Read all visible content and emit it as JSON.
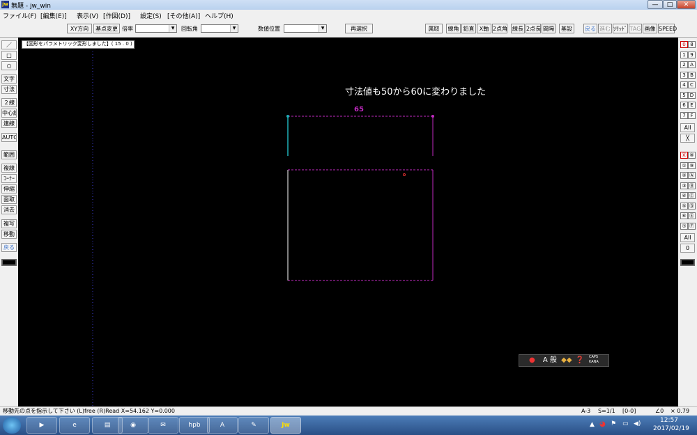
{
  "window": {
    "title": "無題 - jw_win",
    "app_icon": "jw",
    "minimize": "—",
    "maximize": "□",
    "close": "✕"
  },
  "menu": [
    "ファイル(F)",
    "[編集(E)]",
    "表示(V)",
    "[作図(D)]",
    "設定(S)",
    "[その他(A)]",
    "ヘルプ(H)"
  ],
  "toolbar": {
    "xy_direction": "XY方向",
    "base_change": "基点変更",
    "scale_label": "倍率",
    "scale_value": "",
    "rotation_label": "回転角",
    "rotation_value": "",
    "numpos_label": "数値位置",
    "numpos_value": "",
    "reselect": "再選択",
    "right_buttons": [
      "属取",
      "線角",
      "鉛直",
      "X軸",
      "2点角",
      "線長",
      "2点長",
      "間隔",
      "基設"
    ],
    "far_right": [
      "戻る",
      "進む",
      "ｿﾘｯﾄﾞ",
      "TAG",
      "画像",
      "SPEED"
    ]
  },
  "left_tools": [
    "／",
    "□",
    "○",
    "文字",
    "寸法",
    "２線",
    "中心線",
    "連線",
    "AUTO",
    "範囲",
    "複線",
    "ｺｰﾅｰ",
    "伸縮",
    "面取",
    "消去",
    "複写",
    "移動",
    "戻る"
  ],
  "right_layers": {
    "group_a": [
      [
        "0",
        "8"
      ],
      [
        "1",
        "9"
      ],
      [
        "2",
        "A"
      ],
      [
        "3",
        "B"
      ],
      [
        "4",
        "C"
      ],
      [
        "5",
        "D"
      ],
      [
        "6",
        "E"
      ],
      [
        "7",
        "F"
      ]
    ],
    "all_a": "All",
    "x_a": "╳",
    "group_b": [
      [
        "⓪",
        "⑧"
      ],
      [
        "①",
        "⑨"
      ],
      [
        "②",
        "Ⓐ"
      ],
      [
        "③",
        "Ⓑ"
      ],
      [
        "④",
        "Ⓒ"
      ],
      [
        "⑤",
        "Ⓓ"
      ],
      [
        "⑥",
        "Ⓔ"
      ],
      [
        "⑦",
        "Ⓕ"
      ]
    ],
    "all_b": "All",
    "zero_b": "0"
  },
  "canvas": {
    "message": "【図形をパラメトリック変形しました】( 15 . 0 )",
    "annotation": "寸法値も50から60に変わりました",
    "dimension_value": "65",
    "colors": {
      "magenta": "#c02ac0",
      "cyan": "#1fb0b8",
      "white": "#ffffff"
    }
  },
  "ime": {
    "label": "A 般",
    "caps": "CAPS",
    "kana": "KANA"
  },
  "status": {
    "prompt": "移動先の点を指示して下さい (L)free (R)Read X=54.162 Y=0.000",
    "paper": "A-3",
    "scale": "S=1/1",
    "layer": "[0-0]",
    "angle": "∠0",
    "zoom": "× 0.79"
  },
  "taskbar": {
    "apps": [
      "media-player",
      "internet-explorer",
      "file-explorer",
      "chrome",
      "mail",
      "hpb",
      "autocad",
      "paint",
      "jw_cad"
    ],
    "hpb_label": "hpb",
    "jw_label": "Jw",
    "time": "12:57",
    "date": "2017/02/19"
  }
}
